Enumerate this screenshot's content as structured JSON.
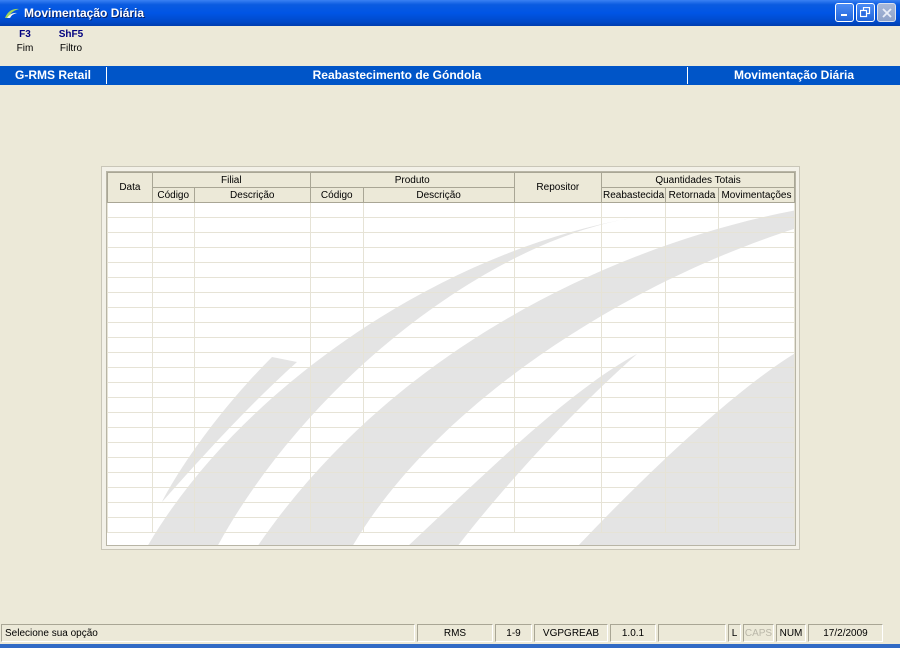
{
  "window": {
    "title": "Movimentação Diária",
    "controls": {
      "minimize": "_",
      "restore": "❐",
      "close": "✕"
    }
  },
  "function_keys": [
    {
      "key": "F3",
      "label": "Fim"
    },
    {
      "key": "ShF5",
      "label": "Filtro"
    }
  ],
  "header": {
    "left": "G-RMS Retail",
    "center": "Reabastecimento de Góndola",
    "right": "Movimentação Diária",
    "color": "#0055C8"
  },
  "grid": {
    "groups": {
      "data": "Data",
      "filial": "Filial",
      "produto": "Produto",
      "repositor": "Repositor",
      "quantidades": "Quantidades Totais"
    },
    "columns": {
      "filial_codigo": "Código",
      "filial_descricao": "Descrição",
      "produto_codigo": "Código",
      "produto_descricao": "Descrição",
      "reabastecida": "Reabastecida",
      "retornada": "Retornada",
      "movimentacoes": "Movimentações"
    },
    "rows": []
  },
  "statusbar": {
    "message": "Selecione sua opção",
    "system": "RMS",
    "code": "1-9",
    "program": "VGPGREAB",
    "version": "1.0.1",
    "empty": "",
    "l": "L",
    "caps": "CAPS",
    "num": "NUM",
    "date": "17/2/2009"
  },
  "icons": {
    "app": "rms-app-icon",
    "watermark": "swoosh-watermark"
  }
}
